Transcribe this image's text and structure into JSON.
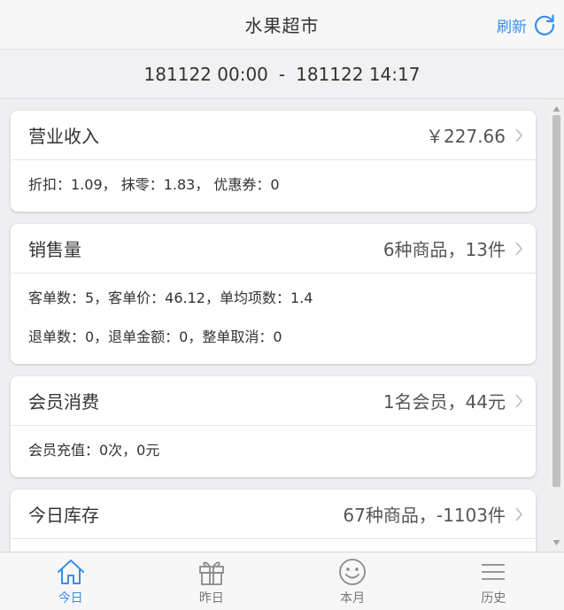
{
  "header": {
    "title": "水果超市",
    "refresh_label": "刷新"
  },
  "date_range": {
    "start": "181122 00:00",
    "separator": "-",
    "end": "181122 14:17"
  },
  "cards": [
    {
      "title": "营业收入",
      "value": "￥227.66",
      "lines": [
        "折扣：1.09， 抹零：1.83， 优惠券：0"
      ]
    },
    {
      "title": "销售量",
      "value": "6种商品，13件",
      "lines": [
        "客单数：5，客单价：46.12，单均项数：1.4",
        "退单数：0，退单金额：0，整单取消：0"
      ]
    },
    {
      "title": "会员消费",
      "value": "1名会员，44元",
      "lines": [
        "会员充值：0次，0元"
      ]
    },
    {
      "title": "今日库存",
      "value": "67种商品，-1103件",
      "lines": []
    }
  ],
  "tabs": [
    {
      "label": "今日",
      "icon": "home-icon",
      "active": true
    },
    {
      "label": "昨日",
      "icon": "gift-icon",
      "active": false
    },
    {
      "label": "本月",
      "icon": "smiley-icon",
      "active": false
    },
    {
      "label": "历史",
      "icon": "menu-icon",
      "active": false
    }
  ],
  "colors": {
    "accent": "#3a8ee6",
    "background": "#efeff1"
  }
}
